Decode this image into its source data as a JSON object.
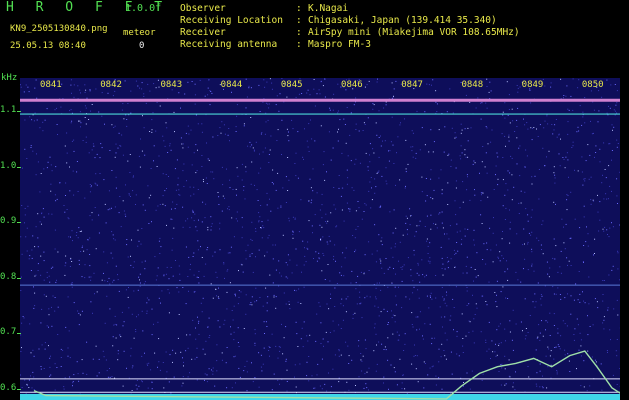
{
  "header": {
    "app_title": "H R O F F T",
    "version": "1.0.0f",
    "filename": "KN9_2505130840.png",
    "meteor_label": "meteor",
    "timestamp": "25.05.13 08:40",
    "meteor_count": "0"
  },
  "meta": [
    {
      "key": "Observer",
      "sep": ":",
      "value": "K.Nagai"
    },
    {
      "key": "Receiving Location",
      "sep": ":",
      "value": "Chigasaki, Japan (139.414 35.340)"
    },
    {
      "key": "Receiver",
      "sep": ":",
      "value": "AirSpy mini (Miakejima VOR 108.65MHz)"
    },
    {
      "key": "Receiving antenna",
      "sep": ":",
      "value": "Maspro FM-3"
    }
  ],
  "chart_data": {
    "type": "heatmap",
    "ylabel": "kHz",
    "x_ticks": [
      "0841",
      "0842",
      "0843",
      "0844",
      "0845",
      "0846",
      "0847",
      "0848",
      "0849",
      "0850"
    ],
    "y_ticks": [
      "1.1",
      "1.0",
      "0.9",
      "0.8",
      "0.7",
      "0.6"
    ],
    "ylim": [
      0.58,
      1.16
    ],
    "lines": [
      {
        "name": "carrier",
        "freq_khz": 1.12
      },
      {
        "name": "cyan-line",
        "freq_khz": 1.095
      },
      {
        "name": "faint-line",
        "freq_khz": 0.787
      },
      {
        "name": "white-line-1",
        "freq_khz": 0.618
      },
      {
        "name": "white-line-2",
        "freq_khz": 0.594
      }
    ],
    "trace": [
      {
        "minute": 0.0,
        "khz": 0.597
      },
      {
        "minute": 0.2,
        "khz": 0.588
      },
      {
        "minute": 6.85,
        "khz": 0.582
      },
      {
        "minute": 7.1,
        "khz": 0.605
      },
      {
        "minute": 7.4,
        "khz": 0.628
      },
      {
        "minute": 7.7,
        "khz": 0.64
      },
      {
        "minute": 8.0,
        "khz": 0.646
      },
      {
        "minute": 8.3,
        "khz": 0.655
      },
      {
        "minute": 8.6,
        "khz": 0.64
      },
      {
        "minute": 8.9,
        "khz": 0.66
      },
      {
        "minute": 9.15,
        "khz": 0.668
      },
      {
        "minute": 9.35,
        "khz": 0.64
      },
      {
        "minute": 9.6,
        "khz": 0.602
      },
      {
        "minute": 9.8,
        "khz": 0.588
      },
      {
        "minute": 10.2,
        "khz": 0.598
      },
      {
        "minute": 10.45,
        "khz": 0.59
      }
    ]
  }
}
